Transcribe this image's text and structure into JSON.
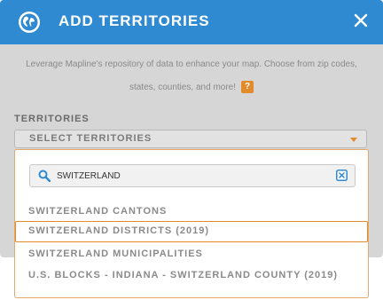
{
  "dialog": {
    "title": "ADD TERRITORIES",
    "description_line1": "Leverage Mapline's repository of data to enhance your map. Choose from zip codes,",
    "description_line2": "states, counties, and more!",
    "help_badge": "?"
  },
  "territories": {
    "label": "TERRITORIES",
    "select_placeholder": "SELECT TERRITORIES"
  },
  "search": {
    "value": "SWITZERLAND"
  },
  "options": [
    {
      "label": "SWITZERLAND CANTONS",
      "selected": false
    },
    {
      "label": "SWITZERLAND DISTRICTS (2019)",
      "selected": true
    },
    {
      "label": "SWITZERLAND MUNICIPALITIES",
      "selected": false
    },
    {
      "label": "U.S. BLOCKS - INDIANA - SWITZERLAND COUNTY (2019)",
      "selected": false
    }
  ],
  "colors": {
    "header": "#2f8ad1",
    "accent": "#e38a2a",
    "overlay": "#d6d6d6"
  },
  "icons": {
    "header": "globe-icon",
    "close": "close-icon",
    "search": "search-icon",
    "clear": "clear-icon",
    "caret": "chevron-down-icon"
  }
}
